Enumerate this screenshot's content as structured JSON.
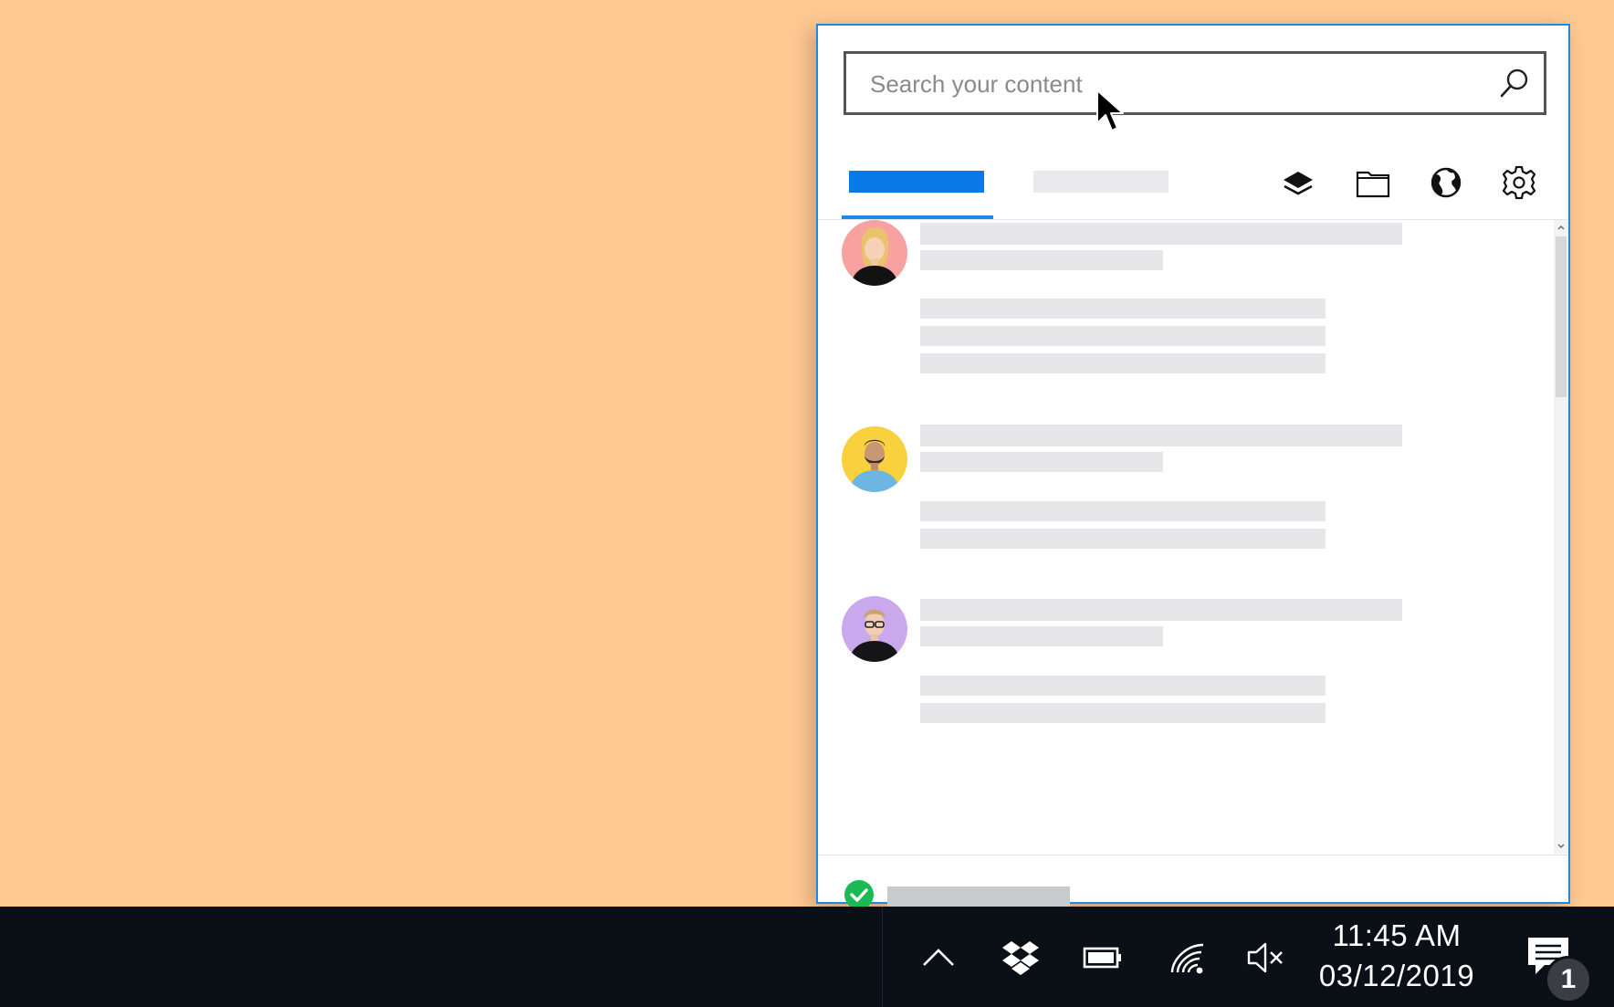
{
  "search": {
    "placeholder": "Search your content",
    "value": ""
  },
  "colors": {
    "desktop": "#FFC993",
    "accent": "#1E88E5",
    "active_tab": "#0A7AE8",
    "skeleton": "#E7E7EA",
    "footer_skeleton": "#C9CACD",
    "success": "#1DB954",
    "taskbar": "#0B0F16"
  },
  "toolbar": {
    "icons": [
      "layers-icon",
      "folder-icon",
      "globe-icon",
      "gear-icon"
    ]
  },
  "feed": {
    "avatars": [
      "avatar-woman",
      "avatar-bearded-man",
      "avatar-man-glasses"
    ]
  },
  "footer": {
    "status_icon": "check-circle-icon"
  },
  "taskbar": {
    "time": "11:45 AM",
    "date": "03/12/2019",
    "notification_count": "1",
    "tray_icons": [
      "chevron-up-icon",
      "dropbox-icon",
      "battery-icon",
      "wifi-icon",
      "volume-mute-icon"
    ]
  }
}
